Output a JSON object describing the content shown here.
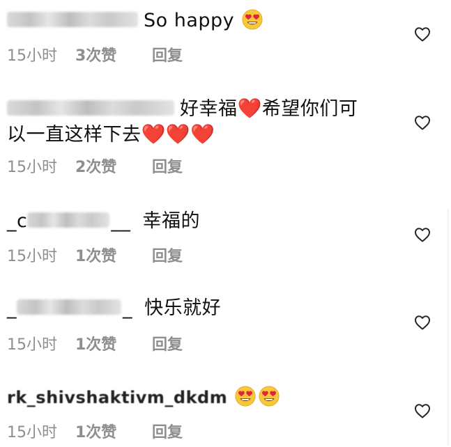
{
  "comments": [
    {
      "text": "So happy",
      "emoji_after": [
        "heart-eyes-emoji"
      ],
      "time": "15小时",
      "likes": "3次赞",
      "reply": "回复"
    },
    {
      "text_line1": "好幸福",
      "text_mid": "希望你们可",
      "text_line2": "以一直这样下去",
      "time": "15小时",
      "likes": "2次赞",
      "reply": "回复"
    },
    {
      "username_prefix": "_c",
      "username_suffix": "__",
      "text": "幸福的",
      "time": "15小时",
      "likes": "1次赞",
      "reply": "回复"
    },
    {
      "username_prefix": "_",
      "username_suffix": "_",
      "text": "快乐就好",
      "time": "15小时",
      "likes": "1次赞",
      "reply": "回复"
    },
    {
      "username": "rk_shivshaktivm_dkdm",
      "time": "15小时",
      "likes": "1次赞",
      "reply": "回复"
    }
  ],
  "icons": {
    "like": "heart-outline-icon",
    "heart": "red-heart-emoji",
    "love_eyes": "heart-eyes-emoji"
  },
  "colors": {
    "text": "#111111",
    "meta": "#8e8e8e",
    "heart": "#e0243a",
    "emoji_face": "#f9c73a"
  }
}
